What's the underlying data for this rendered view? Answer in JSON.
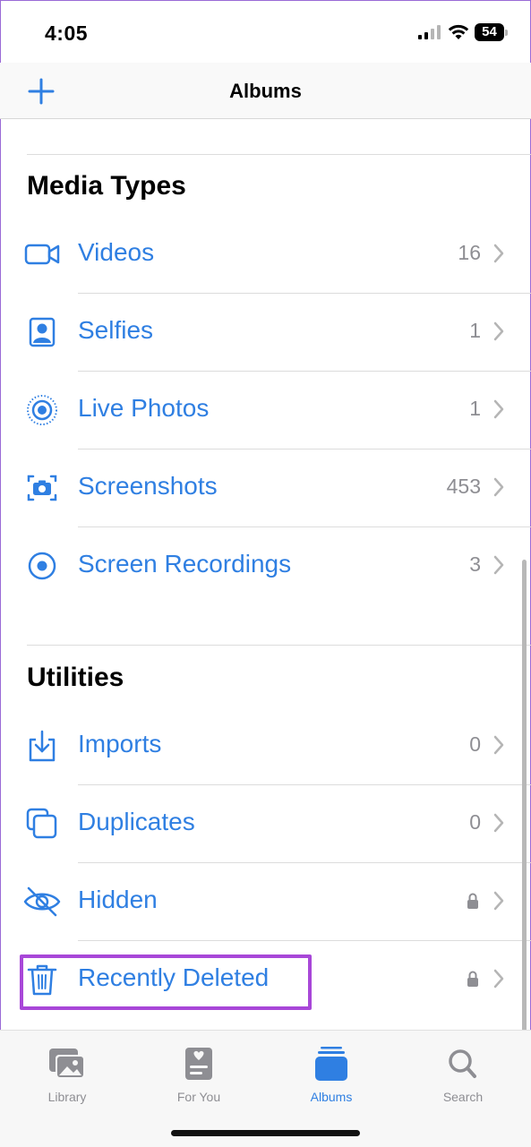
{
  "status_bar": {
    "time": "4:05",
    "battery_level": "54"
  },
  "nav": {
    "title": "Albums"
  },
  "media_types": {
    "title": "Media Types",
    "items": [
      {
        "label": "Videos",
        "count": "16",
        "icon": "video-icon"
      },
      {
        "label": "Selfies",
        "count": "1",
        "icon": "selfie-icon"
      },
      {
        "label": "Live Photos",
        "count": "1",
        "icon": "live-photo-icon"
      },
      {
        "label": "Screenshots",
        "count": "453",
        "icon": "screenshot-icon"
      },
      {
        "label": "Screen Recordings",
        "count": "3",
        "icon": "screen-recording-icon"
      }
    ]
  },
  "utilities": {
    "title": "Utilities",
    "items": [
      {
        "label": "Imports",
        "count": "0",
        "icon": "import-icon"
      },
      {
        "label": "Duplicates",
        "count": "0",
        "icon": "duplicates-icon"
      },
      {
        "label": "Hidden",
        "locked": true,
        "icon": "eye-slash-icon"
      },
      {
        "label": "Recently Deleted",
        "locked": true,
        "icon": "trash-icon"
      }
    ]
  },
  "tab_bar": {
    "tabs": [
      {
        "label": "Library",
        "icon": "photo-library-icon"
      },
      {
        "label": "For You",
        "icon": "for-you-icon"
      },
      {
        "label": "Albums",
        "icon": "albums-icon",
        "active": true
      },
      {
        "label": "Search",
        "icon": "search-icon"
      }
    ]
  },
  "colors": {
    "accent": "#2f7fe2",
    "highlight": "#a847d8",
    "secondary_text": "#8e8e93"
  }
}
